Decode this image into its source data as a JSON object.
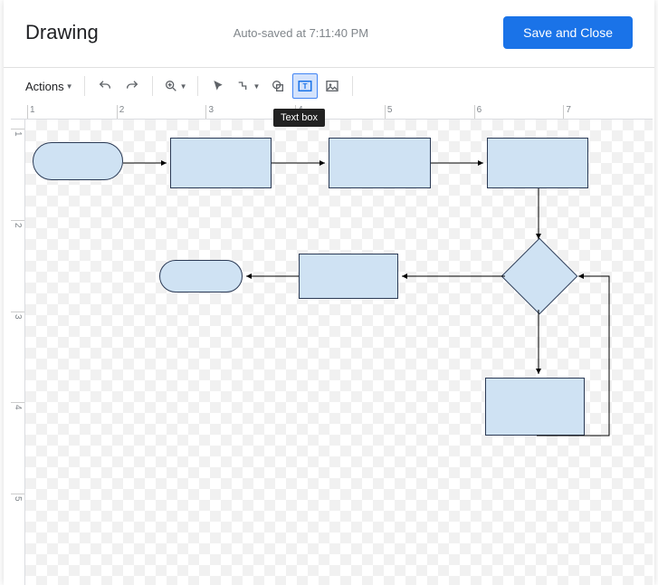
{
  "header": {
    "title": "Drawing",
    "autosave": "Auto-saved at 7:11:40 PM",
    "save_button": "Save and Close"
  },
  "toolbar": {
    "actions_label": "Actions",
    "tooltip": "Text box"
  },
  "ruler": {
    "h": [
      "1",
      "2",
      "3",
      "4",
      "5",
      "6",
      "7"
    ],
    "v": [
      "1",
      "2",
      "3",
      "4",
      "5"
    ]
  },
  "diagram": {
    "shapes": [
      {
        "id": "start",
        "type": "roundrect"
      },
      {
        "id": "step1",
        "type": "rect"
      },
      {
        "id": "step2",
        "type": "rect"
      },
      {
        "id": "step3",
        "type": "rect"
      },
      {
        "id": "decision",
        "type": "diamond"
      },
      {
        "id": "step4",
        "type": "rect"
      },
      {
        "id": "end",
        "type": "roundrect"
      },
      {
        "id": "step5",
        "type": "rect"
      }
    ],
    "arrows": [
      [
        "start",
        "step1"
      ],
      [
        "step1",
        "step2"
      ],
      [
        "step2",
        "step3"
      ],
      [
        "step3",
        "decision"
      ],
      [
        "decision",
        "step4"
      ],
      [
        "step4",
        "end"
      ],
      [
        "decision",
        "step5"
      ],
      [
        "step5",
        "decision"
      ]
    ]
  }
}
